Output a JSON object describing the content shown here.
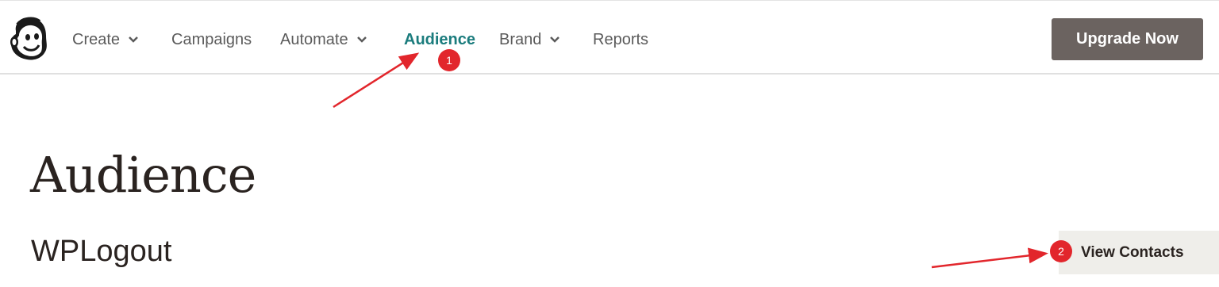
{
  "nav": {
    "logo_icon": "mailchimp-freddie-logo",
    "items": [
      {
        "label": "Create",
        "has_dropdown": true,
        "active": false
      },
      {
        "label": "Campaigns",
        "has_dropdown": false,
        "active": false
      },
      {
        "label": "Automate",
        "has_dropdown": true,
        "active": false
      },
      {
        "label": "Audience",
        "has_dropdown": false,
        "active": true
      },
      {
        "label": "Brand",
        "has_dropdown": true,
        "active": false
      },
      {
        "label": "Reports",
        "has_dropdown": false,
        "active": false
      }
    ],
    "upgrade_label": "Upgrade Now"
  },
  "main": {
    "page_title": "Audience",
    "audience_name": "WPLogout",
    "view_contacts_label": "View Contacts"
  },
  "annotations": {
    "badge_1": "1",
    "badge_2": "2"
  },
  "colors": {
    "active_nav": "#1b7c7d",
    "nav_text": "#5b5b5b",
    "upgrade_bg": "#6b6360",
    "annotation_red": "#e2262c",
    "view_contacts_bg": "#efeeea"
  }
}
